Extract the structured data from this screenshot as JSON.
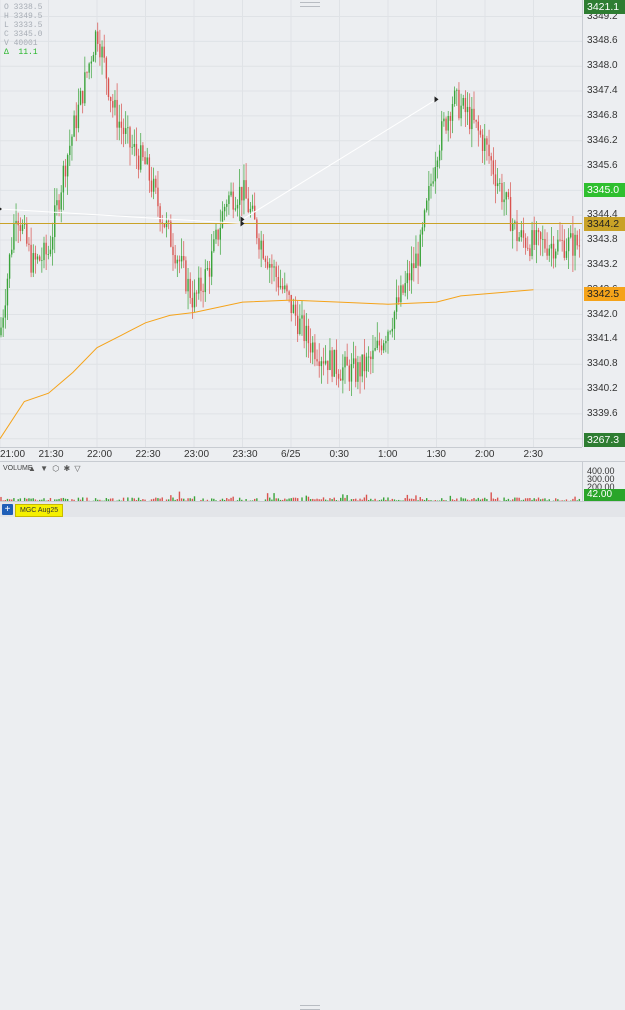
{
  "chart_data": {
    "type": "candlestick",
    "symbol": "MGC Aug25",
    "ohlc_header": {
      "open": "O 3338.5",
      "high": "H 3349.5",
      "low": "L 3333.5",
      "close": "C 3345.0",
      "volume": "V 40001",
      "change": "11.1",
      "change_symbol": "Δ"
    },
    "price_ticks": [
      "3349.2",
      "3348.6",
      "3348.0",
      "3347.4",
      "3346.8",
      "3346.2",
      "3345.6",
      "3345.0",
      "3344.4",
      "3343.8",
      "3343.2",
      "3342.6",
      "3342.0",
      "3341.4",
      "3340.8",
      "3340.2",
      "3339.6",
      "3339.0"
    ],
    "price_range": [
      3338.8,
      3349.6
    ],
    "time_ticks": [
      "21:00",
      "21:30",
      "22:00",
      "22:30",
      "23:00",
      "23:30",
      "6/25",
      "0:30",
      "1:00",
      "1:30",
      "2:00",
      "2:30"
    ],
    "tags": {
      "high": {
        "text": "3421.1",
        "price": 3349.58,
        "color": "#2e7d32",
        "text_color": "#ffffff"
      },
      "last": {
        "text": "3345.0",
        "price": 3345.0,
        "color": "#2fbf2f",
        "text_color": "#ffffff"
      },
      "line": {
        "text": "3344.2",
        "price": 3344.2,
        "color": "#c9a227",
        "text_color": "#222222"
      },
      "vwap": {
        "text": "3342.5",
        "price": 3342.5,
        "color": "#f5a31a",
        "text_color": "#222222"
      },
      "bottom": {
        "text": "3267.3",
        "price": 3338.8,
        "color": "#2e7d32",
        "text_color": "#ffffff"
      }
    },
    "horizontal_line": 3344.2,
    "trend_lines": [
      {
        "from": [
          "21:00",
          3344.55
        ],
        "to": [
          "23:30",
          3344.2
        ]
      },
      {
        "from": [
          "23:30",
          3344.3
        ],
        "to": [
          "1:30",
          3347.2
        ]
      }
    ],
    "vwap_points": [
      [
        "21:00",
        3339.0
      ],
      [
        "21:15",
        3339.9
      ],
      [
        "21:30",
        3340.1
      ],
      [
        "21:45",
        3340.6
      ],
      [
        "22:00",
        3341.2
      ],
      [
        "22:15",
        3341.5
      ],
      [
        "22:30",
        3341.8
      ],
      [
        "22:45",
        3341.98
      ],
      [
        "23:00",
        3342.05
      ],
      [
        "23:30",
        3342.3
      ],
      [
        "6/25",
        3342.35
      ],
      [
        "0:30",
        3342.3
      ],
      [
        "1:00",
        3342.25
      ],
      [
        "1:30",
        3342.3
      ],
      [
        "1:45",
        3342.45
      ],
      [
        "2:00",
        3342.5
      ],
      [
        "2:30",
        3342.6
      ]
    ],
    "close_path": [
      [
        "21:00",
        3341.5
      ],
      [
        "21:10",
        3344.6
      ],
      [
        "21:20",
        3343.2
      ],
      [
        "21:30",
        3343.5
      ],
      [
        "21:40",
        3345.6
      ],
      [
        "21:50",
        3347.2
      ],
      [
        "22:00",
        3348.9
      ],
      [
        "22:10",
        3347.0
      ],
      [
        "22:20",
        3346.1
      ],
      [
        "22:30",
        3345.6
      ],
      [
        "22:40",
        3344.4
      ],
      [
        "22:50",
        3343.4
      ],
      [
        "23:00",
        3342.3
      ],
      [
        "23:10",
        3343.2
      ],
      [
        "23:20",
        3344.8
      ],
      [
        "23:30",
        3345.0
      ],
      [
        "23:40",
        3343.9
      ],
      [
        "23:50",
        3343.0
      ],
      [
        "6/25",
        3342.2
      ],
      [
        "0:10",
        3341.4
      ],
      [
        "0:20",
        3341.0
      ],
      [
        "0:30",
        3340.7
      ],
      [
        "0:40",
        3340.6
      ],
      [
        "0:50",
        3340.9
      ],
      [
        "1:00",
        3341.7
      ],
      [
        "1:10",
        3342.6
      ],
      [
        "1:20",
        3343.6
      ],
      [
        "1:30",
        3346.0
      ],
      [
        "1:40",
        3347.2
      ],
      [
        "1:50",
        3346.8
      ],
      [
        "2:00",
        3346.1
      ],
      [
        "2:10",
        3345.0
      ],
      [
        "2:20",
        3343.9
      ],
      [
        "2:30",
        3343.7
      ]
    ],
    "volume_pane": {
      "title": "VOLUME",
      "ticks": [
        "400.00",
        "300.00",
        "200.00",
        "100.00"
      ],
      "last": "42.00",
      "max": 420
    }
  },
  "bottom_bar": {
    "add_symbol": "+",
    "tab_label": "MGC Aug25"
  },
  "icons": {
    "volume_controls": "▲ ▼ ⬡ ✱ ▽"
  }
}
